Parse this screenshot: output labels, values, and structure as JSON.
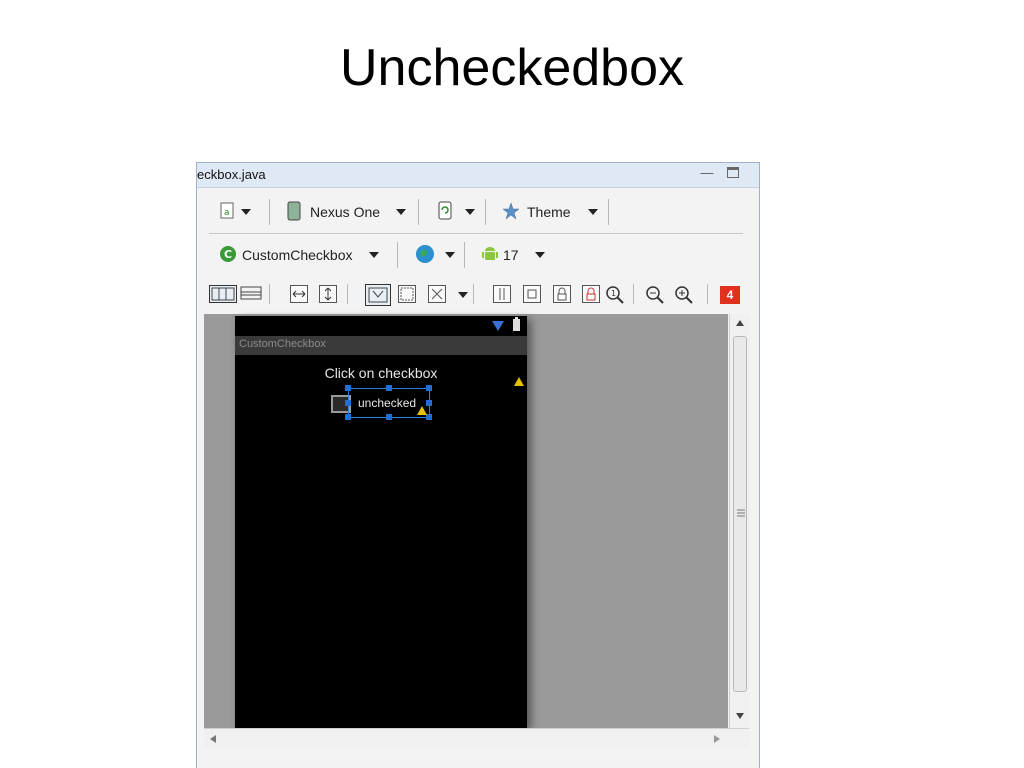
{
  "slide": {
    "title": "Uncheckedbox"
  },
  "window": {
    "tab_title": "eckbox.java",
    "minimize_glyph": "—"
  },
  "toolbar_row1": {
    "device": "Nexus One",
    "theme": "Theme"
  },
  "toolbar_row2": {
    "activity": "CustomCheckbox",
    "api_level": "17"
  },
  "toolbar_row3": {
    "error_count": "4"
  },
  "device_screen": {
    "app_title": "CustomCheckbox",
    "prompt": "Click on checkbox",
    "checkbox_label": "unchecked"
  },
  "icons": {
    "layout-file": "file-icon",
    "device": "phone-icon",
    "orientation": "rotate-icon",
    "theme": "star-icon",
    "activity": "activity-c-icon",
    "locale": "globe-icon",
    "android": "android-icon",
    "error-badge": "error-badge-icon"
  },
  "colors": {
    "accent_selection": "#2a7fe0",
    "warning": "#e6c200",
    "error_badge": "#e0301e",
    "device_bg": "#000000"
  }
}
